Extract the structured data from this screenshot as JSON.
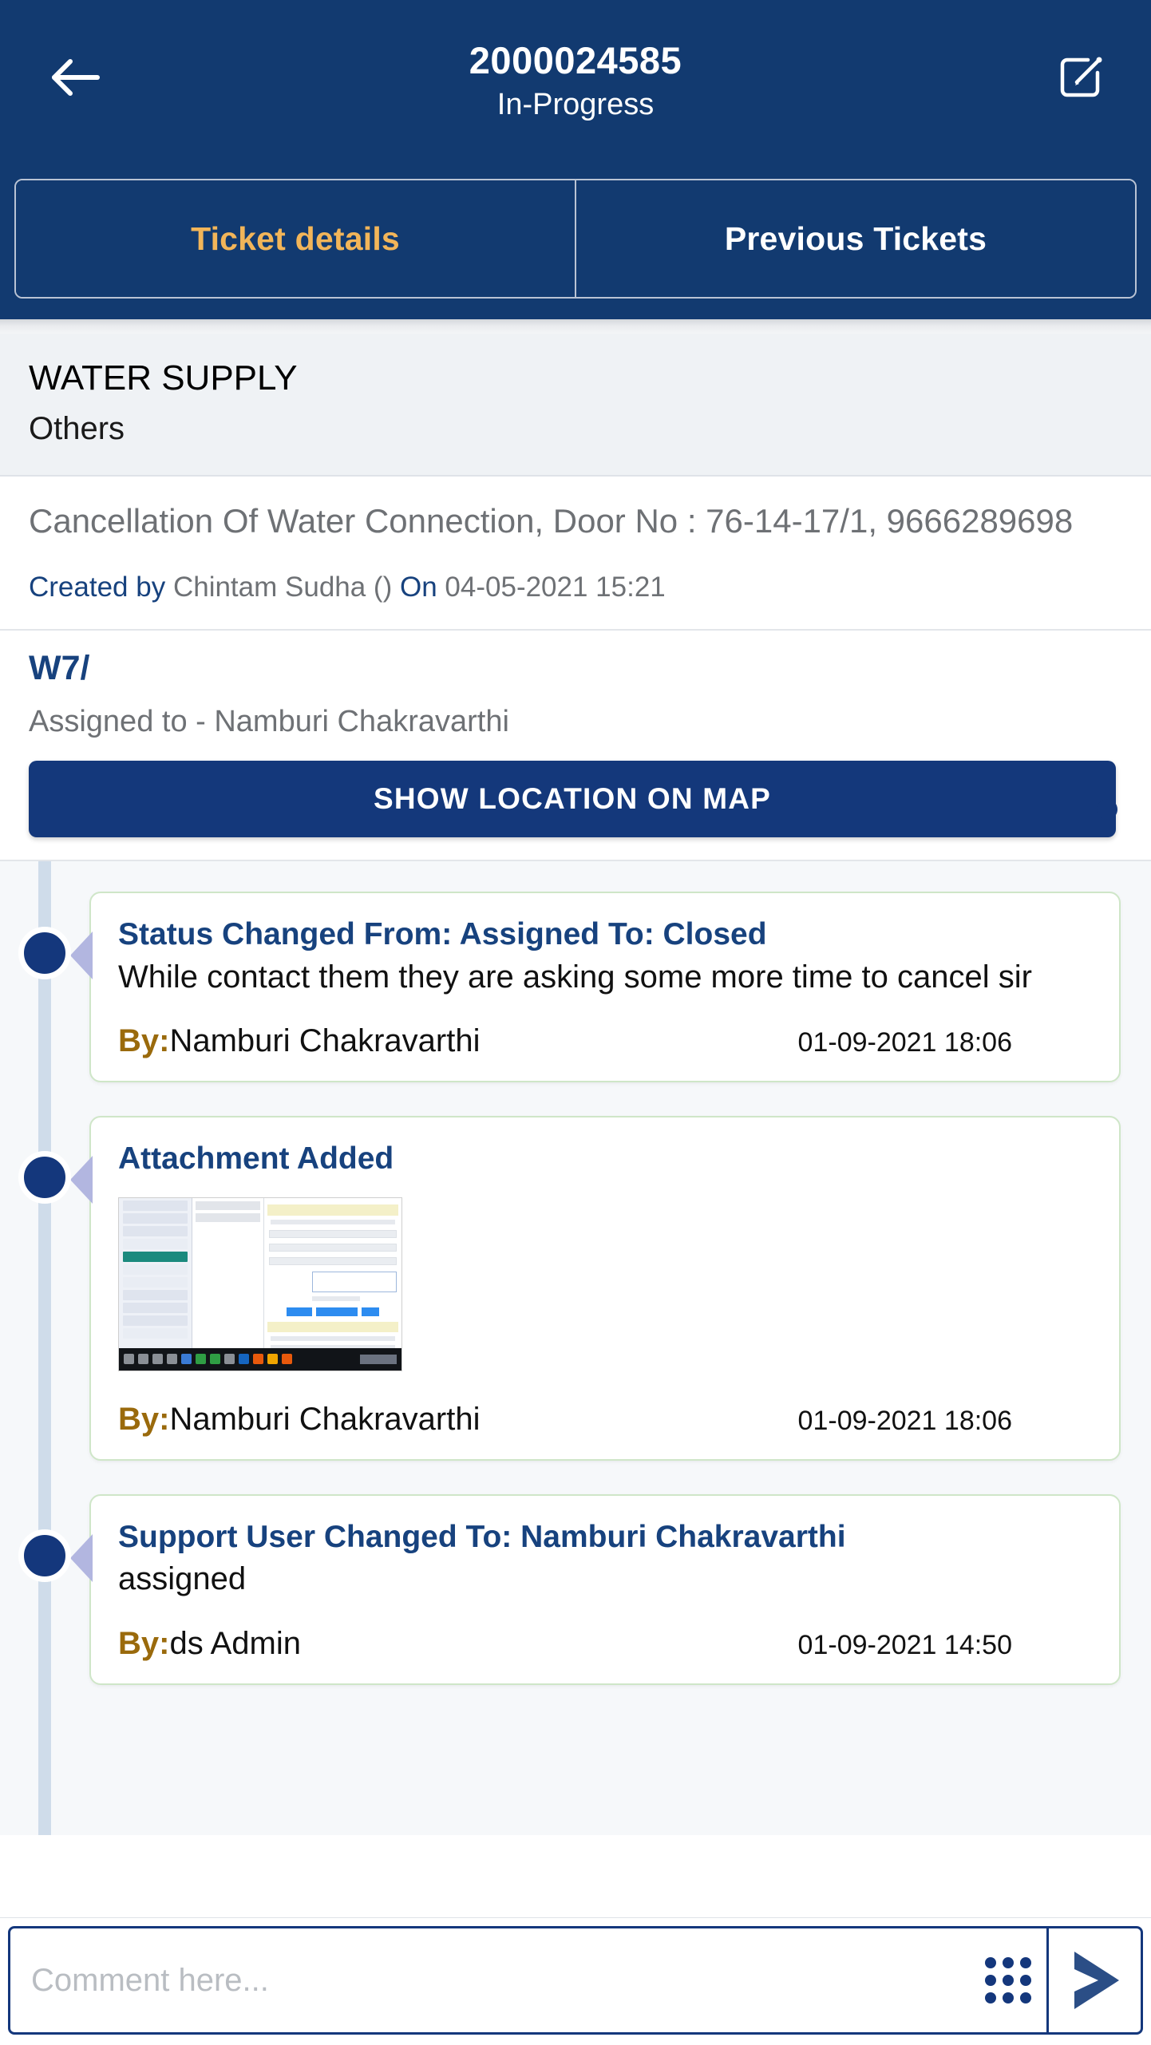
{
  "header": {
    "back_icon": "arrow-left-icon",
    "edit_icon": "edit-square-pencil-icon",
    "title": "2000024585",
    "status": "In-Progress"
  },
  "tabs": [
    {
      "label": "Ticket details",
      "active": true
    },
    {
      "label": "Previous Tickets",
      "active": false
    }
  ],
  "category": {
    "department": "WATER SUPPLY",
    "type": "Others"
  },
  "description": {
    "text": "Cancellation Of Water Connection, Door No : 76-14-17/1, 9666289698",
    "created_label": "Created by",
    "created_by": "Chintam Sudha ()",
    "on_label": "On",
    "created_on": "04-05-2021 15:21"
  },
  "assignment": {
    "code": "W7/",
    "assigned_to": "Assigned to - Namburi Chakravarthi",
    "map_button": "SHOW LOCATION ON MAP"
  },
  "timeline": [
    {
      "title": "Status Changed From: Assigned To: Closed",
      "body": "While contact them they are asking some more time to cancel sir",
      "by_label": "By:",
      "by": "Namburi Chakravarthi",
      "time": "01-09-2021 18:06",
      "has_attachment": false
    },
    {
      "title": "Attachment Added",
      "body": "",
      "by_label": "By:",
      "by": "Namburi Chakravarthi",
      "time": "01-09-2021 18:06",
      "has_attachment": true,
      "attachment_name": "attachment-thumbnail"
    },
    {
      "title": "Support User Changed To: Namburi Chakravarthi",
      "body": "assigned",
      "by_label": "By:",
      "by": "ds Admin",
      "time": "01-09-2021 14:50",
      "has_attachment": false
    }
  ],
  "comment_bar": {
    "placeholder": "Comment here...",
    "value": "",
    "grid_icon": "grid-dots-icon",
    "send_icon": "send-arrow-icon"
  },
  "colors": {
    "navy": "#123A70",
    "accent_gold": "#F2B559",
    "by_gold": "#9A6A0C",
    "link_navy": "#17427E",
    "card_border_green": "#CFE6C8",
    "section_bg": "#EFF2F5",
    "timeline_line": "#CFDCEA"
  }
}
